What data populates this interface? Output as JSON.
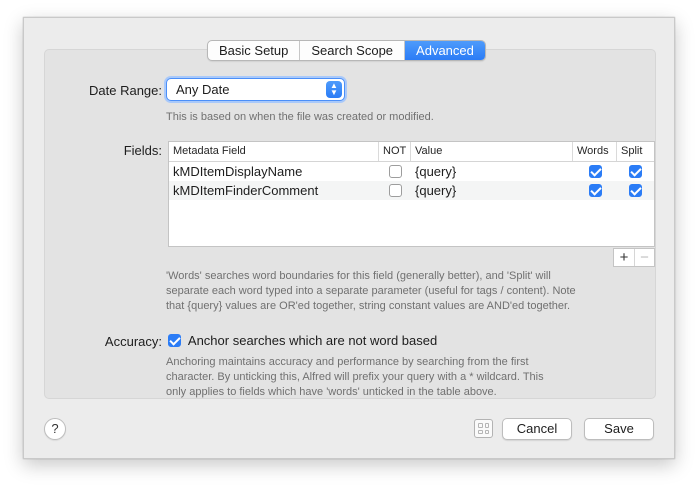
{
  "tabs": [
    {
      "label": "Basic Setup",
      "active": false
    },
    {
      "label": "Search Scope",
      "active": false
    },
    {
      "label": "Advanced",
      "active": true
    }
  ],
  "date_range": {
    "label": "Date Range:",
    "value": "Any Date",
    "note": "This is based on when the file was created or modified."
  },
  "fields": {
    "label": "Fields:",
    "columns": [
      "Metadata Field",
      "NOT",
      "Value",
      "Words",
      "Split"
    ],
    "rows": [
      {
        "field": "kMDItemDisplayName",
        "not": false,
        "value": "{query}",
        "words": true,
        "split": true
      },
      {
        "field": "kMDItemFinderComment",
        "not": false,
        "value": "{query}",
        "words": true,
        "split": true
      }
    ],
    "add": "+",
    "remove": "−",
    "note_lines": [
      "'Words' searches word boundaries for this field (generally better), and 'Split' will",
      "separate each word typed into a separate parameter (useful for tags / content). Note",
      "that {query} values are OR'ed together, string constant values are AND'ed together."
    ]
  },
  "accuracy": {
    "label": "Accuracy:",
    "checkbox_label": "Anchor searches which are not word based",
    "checked": true,
    "note_lines": [
      "Anchoring maintains accuracy and performance by searching from the first",
      "character. By unticking this, Alfred will prefix your query with a * wildcard. This",
      "only applies to fields which have 'words' unticked in the table above."
    ]
  },
  "footer": {
    "help": "?",
    "cancel": "Cancel",
    "save": "Save"
  },
  "colors": {
    "accent": "#2b7cf6"
  }
}
